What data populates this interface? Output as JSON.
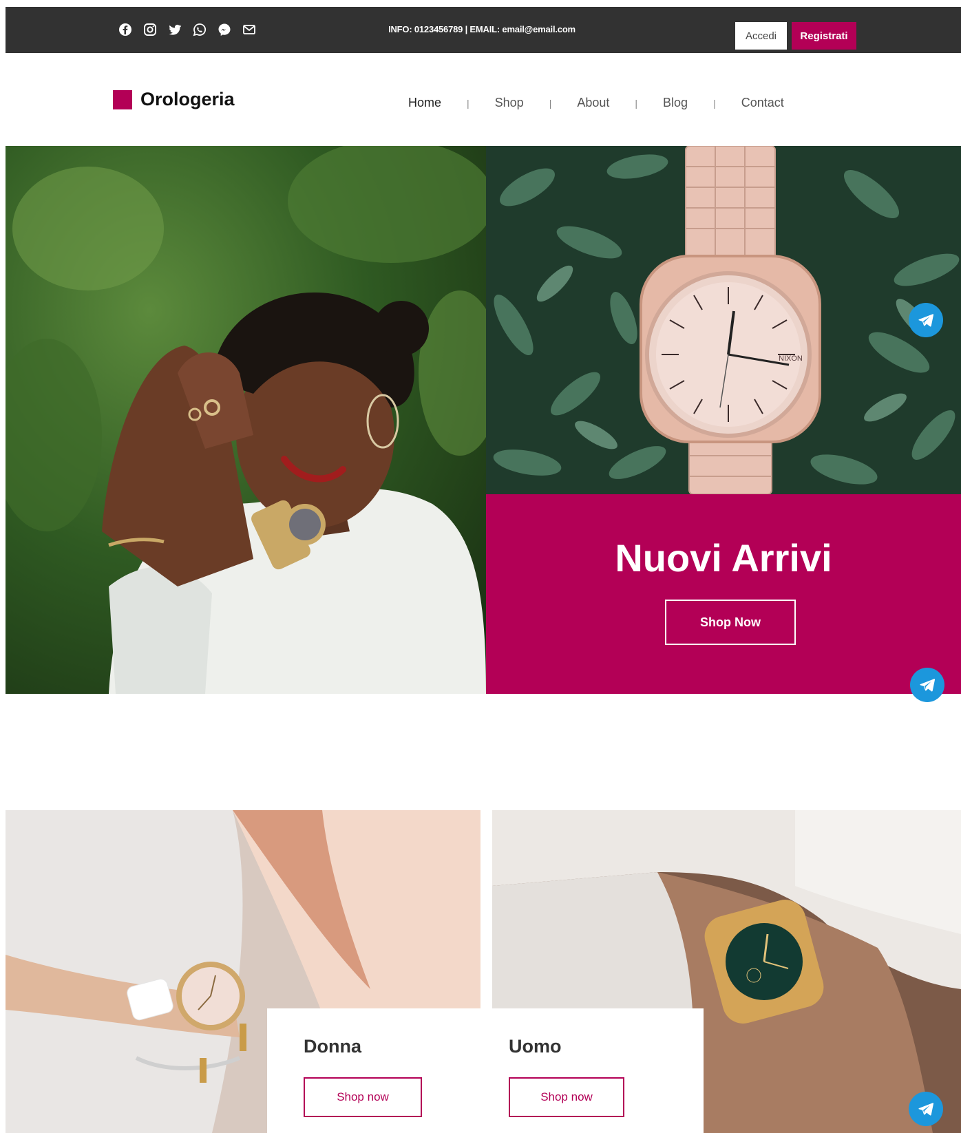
{
  "topbar": {
    "social_icons": [
      "facebook-icon",
      "instagram-icon",
      "twitter-icon",
      "whatsapp-icon",
      "messenger-icon",
      "mail-icon"
    ],
    "info_text": "INFO: 0123456789  |  EMAIL: email@email.com",
    "login_label": "Accedi",
    "register_label": "Registrati"
  },
  "header": {
    "logo": "Orologeria",
    "nav": [
      "Home",
      "Shop",
      "About",
      "Blog",
      "Contact"
    ],
    "separator": "|"
  },
  "hero": {
    "title": "Nuovi Arrivi",
    "button": "Shop Now",
    "brand_on_watch": "NIXON"
  },
  "categories": [
    {
      "title": "Donna",
      "button": "Shop now"
    },
    {
      "title": "Uomo",
      "button": "Shop now"
    }
  ],
  "colors": {
    "accent": "#b30056",
    "topbar": "#323232",
    "telegram": "#1c97dc"
  }
}
